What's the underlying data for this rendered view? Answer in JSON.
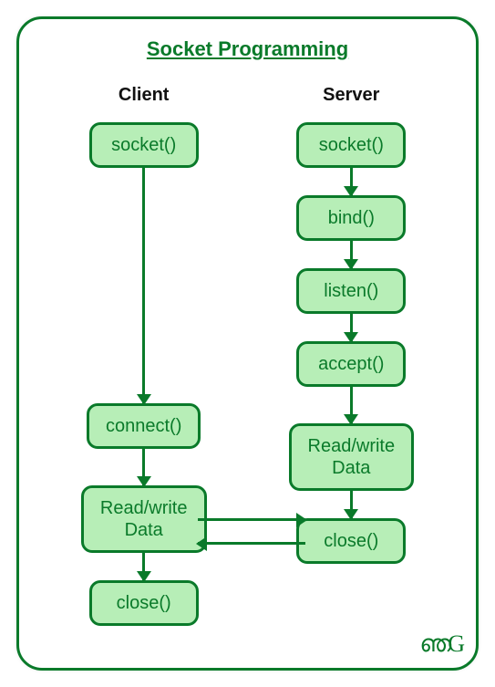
{
  "title": "Socket Programming",
  "columns": {
    "client": {
      "header": "Client",
      "nodes": {
        "socket": "socket()",
        "connect": "connect()",
        "rw": "Read/write\nData",
        "close": "close()"
      }
    },
    "server": {
      "header": "Server",
      "nodes": {
        "socket": "socket()",
        "bind": "bind()",
        "listen": "listen()",
        "accept": "accept()",
        "rw": "Read/write\nData",
        "close": "close()"
      }
    }
  },
  "logo": "ഞG",
  "colors": {
    "border": "#0a7a2a",
    "node_fill": "#b7eeb7",
    "text": "#0a7a2a"
  },
  "chart_data": {
    "type": "diagram",
    "title": "Socket Programming",
    "lanes": [
      {
        "name": "Client",
        "sequence": [
          "socket()",
          "connect()",
          "Read/write Data",
          "close()"
        ]
      },
      {
        "name": "Server",
        "sequence": [
          "socket()",
          "bind()",
          "listen()",
          "accept()",
          "Read/write Data",
          "close()"
        ]
      }
    ],
    "cross_edges": [
      {
        "from": "Client:Read/write Data",
        "to": "Server:Read/write Data",
        "direction": "bidirectional"
      }
    ]
  }
}
